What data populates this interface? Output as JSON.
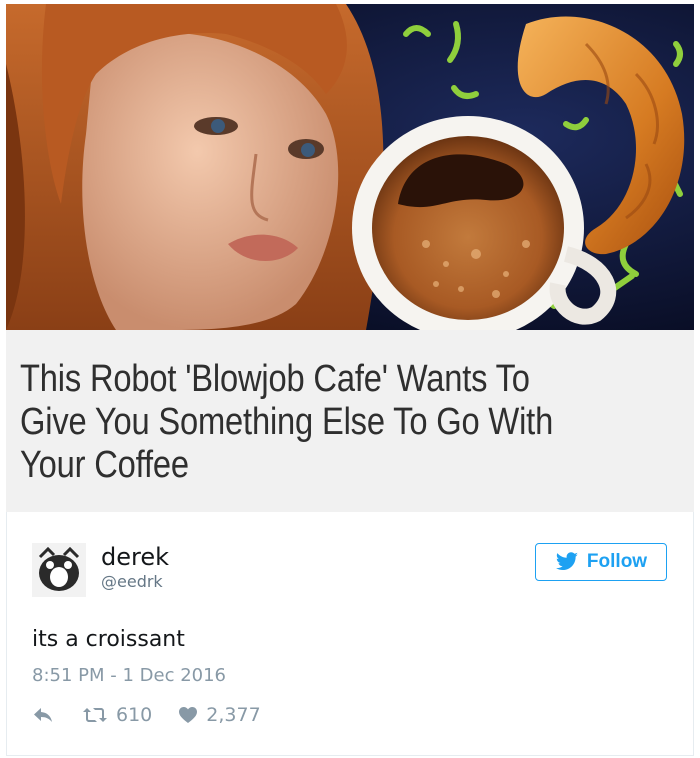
{
  "article": {
    "headline": "This Robot 'Blowjob Cafe' Wants To Give You Something Else To Go With Your Coffee",
    "image": {
      "subjects": [
        "robot-face",
        "coffee-cup",
        "croissant"
      ]
    }
  },
  "tweet": {
    "display_name": "derek",
    "handle": "@eedrk",
    "follow_label": "Follow",
    "text": "its a croissant",
    "timestamp": "8:51 PM - 1 Dec 2016",
    "retweets": "610",
    "likes": "2,377"
  },
  "colors": {
    "twitter_blue": "#1da1f2",
    "meta_gray": "#8899a6",
    "headline_bg": "#f1f1f1"
  },
  "icons": [
    "twitter-bird-icon",
    "reply-icon",
    "retweet-icon",
    "heart-icon"
  ]
}
